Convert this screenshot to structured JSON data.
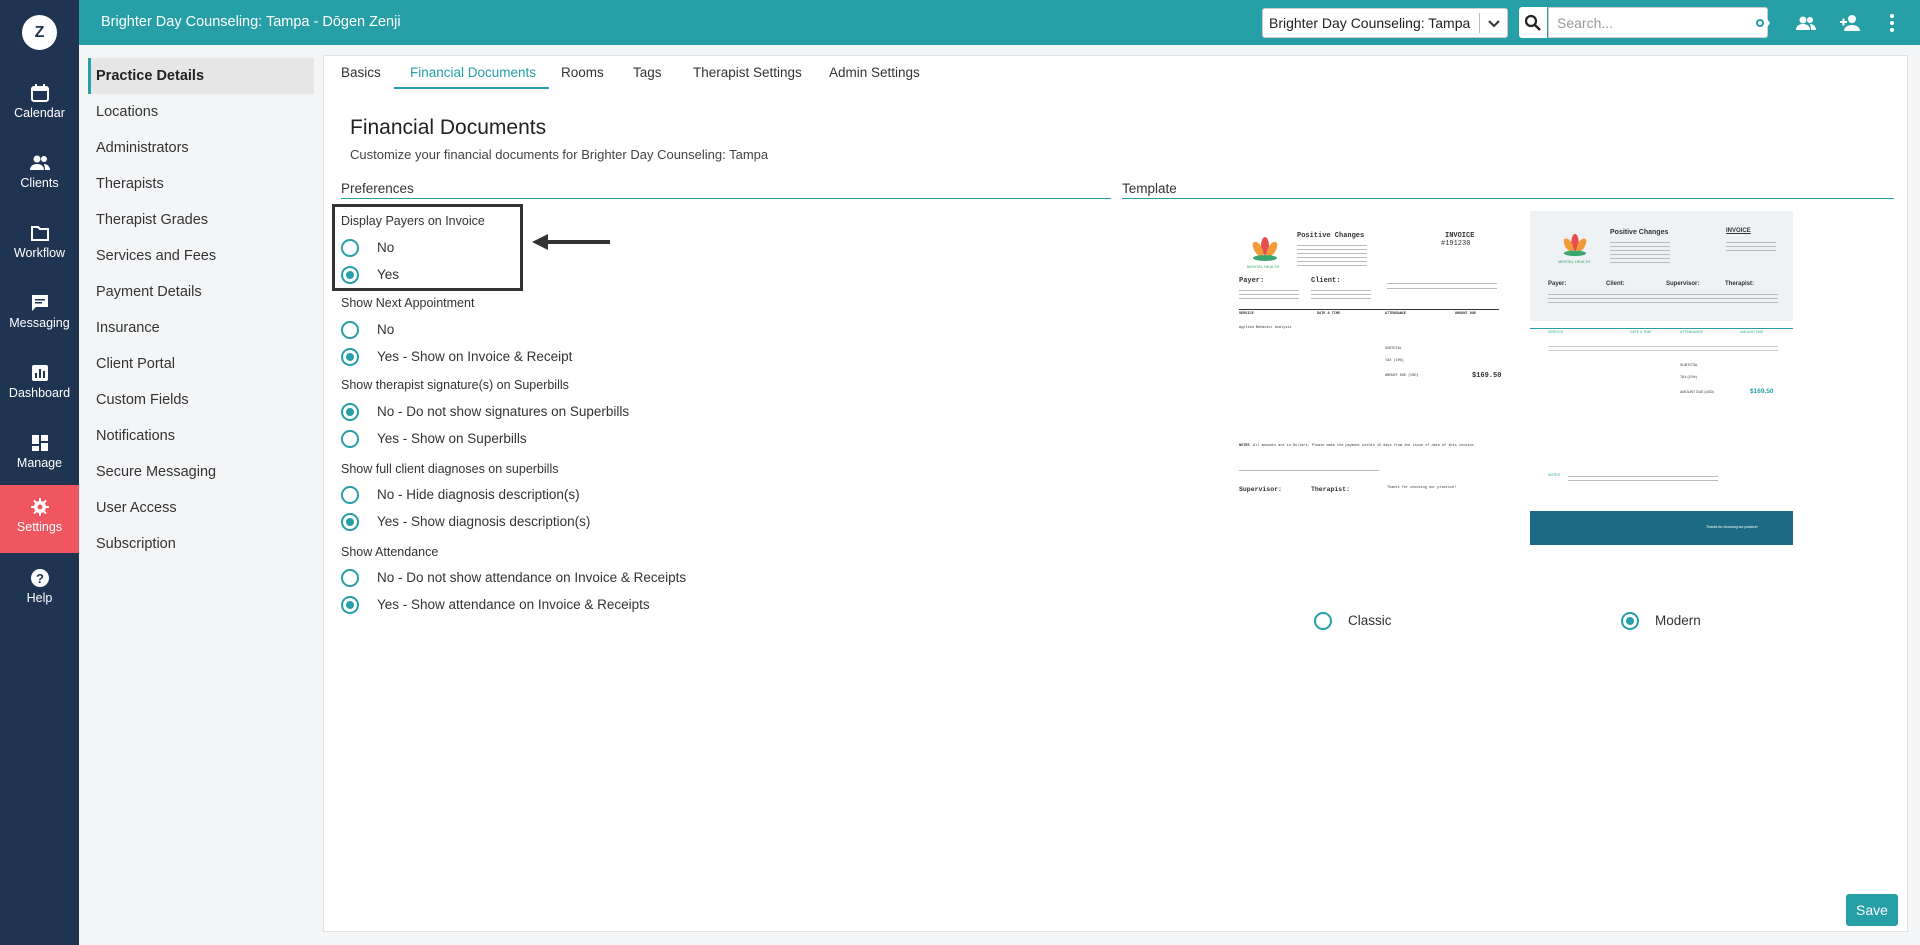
{
  "app": {
    "logo_letter": "Z",
    "title": "Brighter Day Counseling: Tampa - Dōgen Zenji",
    "accent_color": "#26a0a6",
    "nav_bg": "#1f3450",
    "active_nav_color": "#f0565f"
  },
  "leftnav": [
    {
      "label": "Calendar",
      "icon": "calendar-icon"
    },
    {
      "label": "Clients",
      "icon": "clients-icon"
    },
    {
      "label": "Workflow",
      "icon": "folder-icon"
    },
    {
      "label": "Messaging",
      "icon": "message-icon"
    },
    {
      "label": "Dashboard",
      "icon": "chart-icon"
    },
    {
      "label": "Manage",
      "icon": "grid-icon"
    },
    {
      "label": "Settings",
      "icon": "gear-icon"
    },
    {
      "label": "Help",
      "icon": "help-icon"
    }
  ],
  "topbar": {
    "practice_select": "Brighter Day Counseling: Tampa",
    "search_placeholder": "Search...",
    "icons": [
      "bell-icon",
      "eye-icon",
      "people-icon",
      "add-person-icon",
      "more-vertical-icon"
    ]
  },
  "subnav": [
    "Practice Details",
    "Locations",
    "Administrators",
    "Therapists",
    "Therapist Grades",
    "Services and Fees",
    "Payment Details",
    "Insurance",
    "Client Portal",
    "Custom Fields",
    "Notifications",
    "Secure Messaging",
    "User Access",
    "Subscription"
  ],
  "tabs": [
    "Basics",
    "Financial Documents",
    "Rooms",
    "Tags",
    "Therapist Settings",
    "Admin Settings"
  ],
  "main": {
    "heading": "Financial Documents",
    "subheading": "Customize your financial documents for Brighter Day Counseling: Tampa",
    "preferences_label": "Preferences",
    "template_label": "Template",
    "save_label": "Save"
  },
  "preferences": [
    {
      "question": "Display Payers on Invoice",
      "options": [
        "No",
        "Yes"
      ],
      "selected": 1
    },
    {
      "question": "Show Next Appointment",
      "options": [
        "No",
        "Yes - Show on Invoice & Receipt"
      ],
      "selected": 1
    },
    {
      "question": "Show therapist signature(s) on Superbills",
      "options": [
        "No - Do not show signatures on Superbills",
        "Yes - Show on Superbills"
      ],
      "selected": 0
    },
    {
      "question": "Show full client diagnoses on superbills",
      "options": [
        "No - Hide diagnosis description(s)",
        "Yes - Show diagnosis description(s)"
      ],
      "selected": 1
    },
    {
      "question": "Show Attendance",
      "options": [
        "No - Do not show attendance on Invoice & Receipts",
        "Yes - Show attendance on Invoice & Receipts"
      ],
      "selected": 1
    }
  ],
  "templates": {
    "selected": "Modern",
    "classic": {
      "label": "Classic",
      "company": "Positive Changes",
      "doc": "INVOICE",
      "number": "#191230",
      "brand": "MENTAL HEALTH",
      "payer_h": "Payer:",
      "client_h": "Client:",
      "cols": [
        "SERVICE",
        "DATE & TIME",
        "ATTENDANCE",
        "AMOUNT DUE"
      ],
      "service": "Applied Behavior Analysis",
      "subtotal_label": "SUBTOTAL",
      "tax_label": "TAX (10%)",
      "amount_due_label": "AMOUNT DUE (USD)",
      "amount_due": "$169.50",
      "notes_label": "NOTES",
      "notes": "All amounts are in Dollars. Please make the payment within 15 days from the issue of date of this invoice.",
      "supervisor_h": "Supervisor:",
      "therapist_h": "Therapist:",
      "thanks": "Thanks for choosing our practice!"
    },
    "modern": {
      "label": "Modern",
      "company": "Positive Changes",
      "doc": "INVOICE",
      "brand": "MENTAL HEALTH",
      "payer_h": "Payer:",
      "client_h": "Client:",
      "supervisor_h": "Supervisor:",
      "therapist_h": "Therapist:",
      "cols": [
        "SERVICE",
        "DATE & TIME",
        "ATTENDANCE",
        "AMOUNT DUE"
      ],
      "subtotal_label": "SUBTOTAL",
      "tax_label": "TAX (10%)",
      "amount_due_label": "AMOUNT DUE (USD)",
      "amount_due": "$169.50",
      "notes_label": "NOTES",
      "thanks": "Thanks for choosing our practice!"
    }
  }
}
